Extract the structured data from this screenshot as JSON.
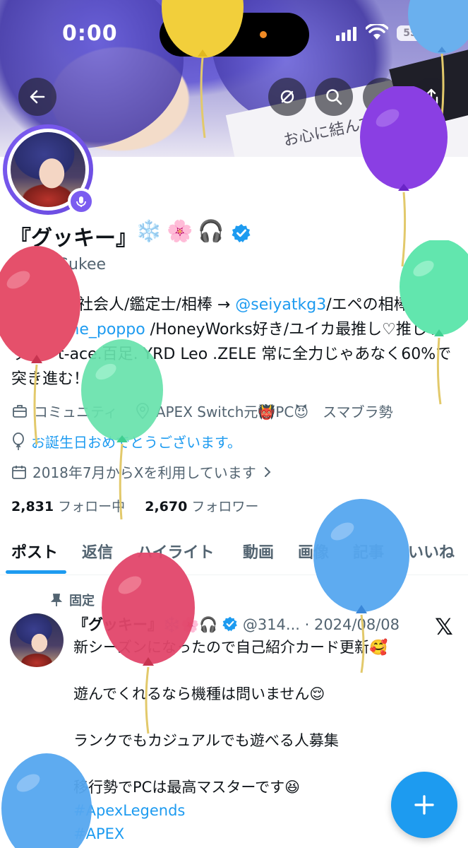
{
  "status_bar": {
    "time": "0:00",
    "battery": "55"
  },
  "profile": {
    "display_name": "『グッキー』",
    "name_emojis": [
      "❄️",
      "🌸",
      "🎧"
    ],
    "handle": "@314Gukee",
    "bio": {
      "part1": "21歳男性社会人/鑑定士/相棒 → ",
      "link1": "@seiyatkg3",
      "part2": "/エペの相棒",
      "part3": "→ ",
      "link2": "@game_poppo",
      "part4": " /HoneyWorks好き/ユイカ最推し♡推しラッパーt-ace.百足. YRD Leo .ZELE 常に全力じゃあなく60%で突き進む！"
    },
    "category": "コミュニティ",
    "location": "APEX Switch元👹PC😈　スマブラ勢",
    "birthday": "お誕生日おめでとうございます。",
    "joined": "2018年7月からXを利用しています",
    "following_count": "2,831",
    "following_label": "フォロー中",
    "followers_count": "2,670",
    "followers_label": "フォロワー"
  },
  "tabs": [
    "ポスト",
    "返信",
    "ハイライト",
    "動画",
    "画像",
    "記事",
    "いいね"
  ],
  "active_tab": "ポスト",
  "post": {
    "pinned_label": "固定",
    "name": "『グッキー』❄️🌸🎧",
    "handle_date": "@314... · 2024/08/08",
    "lines": [
      "新シーズンになったので自己紹介カード更新🥰",
      "",
      "遊んでくれるなら機種は問いません😌",
      "",
      "ランクでもカジュアルでも遊べる人募集",
      "",
      "移行勢でPCは最高マスターです😆"
    ],
    "hashtags": [
      "#ApexLegends",
      "#APEX"
    ]
  },
  "colors": {
    "accent": "#1d9bf0",
    "space_ring": "#7b5cf0"
  }
}
